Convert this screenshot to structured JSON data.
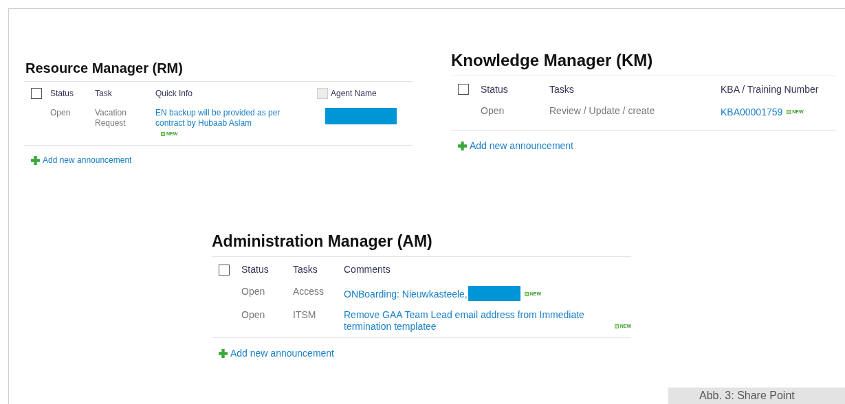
{
  "panels": [
    {
      "title": "Resource Manager (RM)",
      "select_all": {
        "checked": false
      },
      "columns": [
        {
          "label": "Status"
        },
        {
          "label": "Task"
        },
        {
          "label": "Quick Info"
        },
        {
          "label": "Agent Name",
          "checkbox": {
            "checked": false
          }
        }
      ],
      "rows": [
        {
          "cells": [
            {
              "kind": "text",
              "text": "Open"
            },
            {
              "kind": "text",
              "text": "Vacation Request"
            },
            {
              "kind": "link",
              "text": "EN backup will be provided as per contract by Hubaab Aslam",
              "badge": "NEW",
              "badge_below": true
            },
            {
              "kind": "redacted"
            }
          ]
        }
      ],
      "add_link": "Add new announcement"
    },
    {
      "title": "Knowledge Manager (KM)",
      "select_all": {
        "checked": false
      },
      "columns": [
        {
          "label": "Status"
        },
        {
          "label": "Tasks"
        },
        {
          "label": "KBA / Training Number"
        }
      ],
      "rows": [
        {
          "cells": [
            {
              "kind": "text",
              "text": "Open"
            },
            {
              "kind": "text",
              "text": "Review / Update / create"
            },
            {
              "kind": "link",
              "text": "KBA00001759",
              "badge": "NEW"
            }
          ]
        }
      ],
      "add_link": "Add new announcement"
    },
    {
      "title": "Administration Manager (AM)",
      "select_all": {
        "checked": false
      },
      "columns": [
        {
          "label": "Status"
        },
        {
          "label": "Tasks"
        },
        {
          "label": "Comments"
        }
      ],
      "rows": [
        {
          "cells": [
            {
              "kind": "text",
              "text": "Open"
            },
            {
              "kind": "text",
              "text": "Access"
            },
            {
              "kind": "link",
              "text": "ONBoarding: Nieuwkasteele,",
              "redacted": true,
              "badge": "NEW"
            }
          ]
        },
        {
          "cells": [
            {
              "kind": "text",
              "text": "Open"
            },
            {
              "kind": "text",
              "text": "ITSM"
            },
            {
              "kind": "link",
              "text": "Remove GAA Team Lead email address from Immediate termination templatee",
              "badge": "NEW"
            }
          ]
        }
      ],
      "add_link": "Add new announcement"
    }
  ],
  "caption": "Abb. 3: Share Point"
}
